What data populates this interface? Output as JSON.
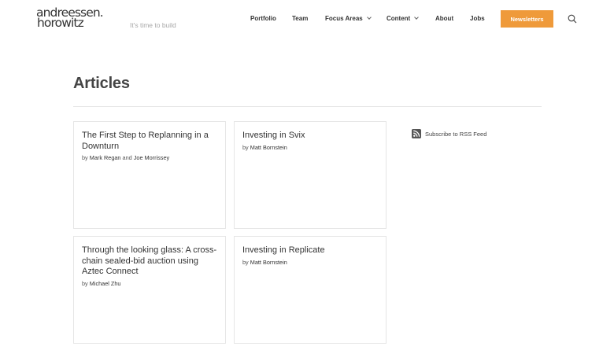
{
  "header": {
    "logo_line1": "andreessen.",
    "logo_line2": "horowitz",
    "tagline": "It's time to build",
    "nav": [
      {
        "label": "Portfolio"
      },
      {
        "label": "Team"
      },
      {
        "label": "Focus Areas",
        "dropdown": true
      },
      {
        "label": "Content",
        "dropdown": true
      },
      {
        "label": "About"
      },
      {
        "label": "Jobs"
      }
    ],
    "newsletter_label": "Newsletters",
    "accent_color": "#ef9a3a",
    "search_icon": "search-icon"
  },
  "main": {
    "title": "Articles",
    "articles": [
      {
        "title": "The First Step to Replanning in a Downturn",
        "by": "by",
        "authors": [
          "Mark Regan",
          "Joe Morrissey"
        ],
        "joiner": "and"
      },
      {
        "title": "Investing in Svix",
        "by": "by",
        "authors": [
          "Matt Bornstein"
        ]
      },
      {
        "title": "Through the looking glass: A cross-chain sealed-bid auction using Aztec Connect",
        "by": "by",
        "authors": [
          "Michael Zhu"
        ]
      },
      {
        "title": "Investing in Replicate",
        "by": "by",
        "authors": [
          "Matt Bornstein"
        ]
      }
    ]
  },
  "sidebar": {
    "rss_label": "Subscribe to RSS Feed",
    "rss_icon": "rss-icon"
  }
}
